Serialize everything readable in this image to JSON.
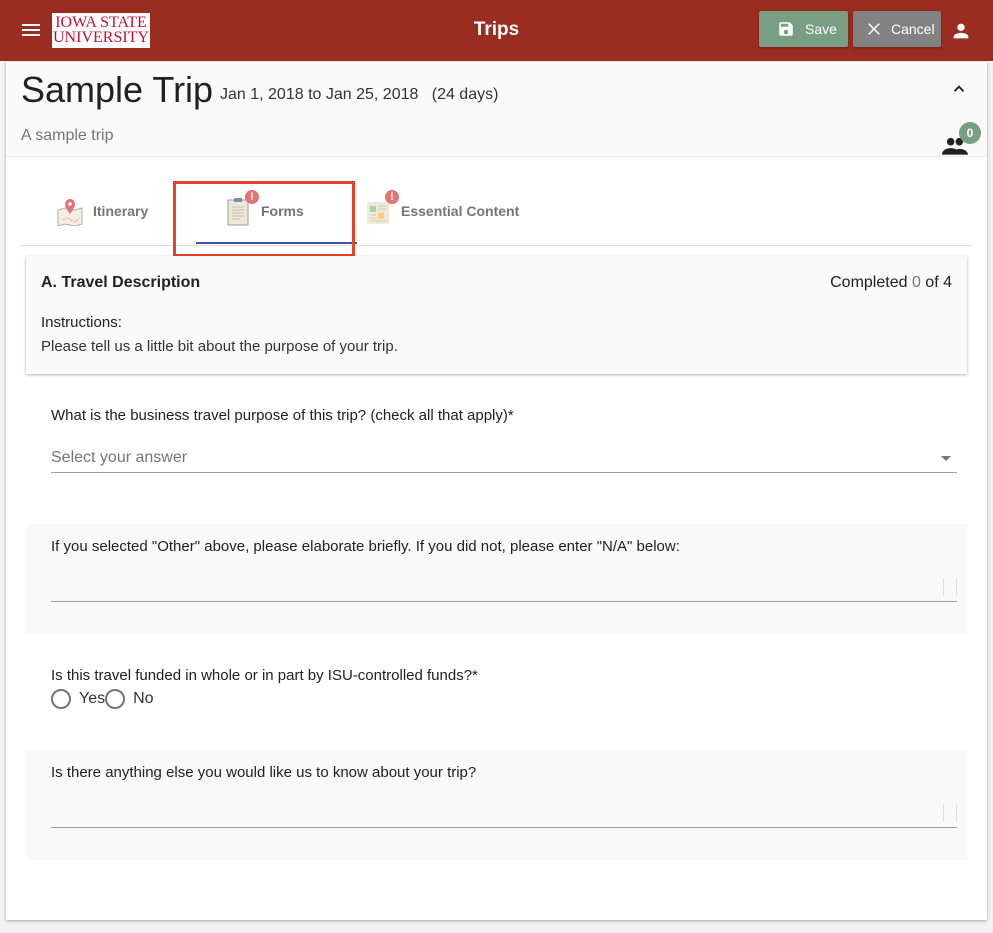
{
  "header": {
    "app_title": "Trips",
    "logo": {
      "line1": "IOWA STATE",
      "line2": "UNIVERSITY"
    },
    "save_label": "Save",
    "cancel_label": "Cancel",
    "colors": {
      "bar": "#9b2d20",
      "save": "#789e83",
      "cancel": "#828282"
    }
  },
  "trip": {
    "title": "Sample Trip",
    "dates": "Jan 1, 2018 to Jan 25, 2018",
    "duration": "(24 days)",
    "description": "A sample trip",
    "participants_count": "0"
  },
  "tabs": [
    {
      "label": "Itinerary",
      "icon": "map-pin-icon",
      "alert": false
    },
    {
      "label": "Forms",
      "icon": "clipboard-icon",
      "alert": true,
      "alert_glyph": "!",
      "active": true
    },
    {
      "label": "Essential Content",
      "icon": "newspaper-icon",
      "alert": true,
      "alert_glyph": "!"
    }
  ],
  "section": {
    "title": "A. Travel Description",
    "progress_prefix": "Completed",
    "completed": "0",
    "progress_mid": "of",
    "total": "4",
    "instructions_label": "Instructions:",
    "instructions_text": "Please tell us a little bit about the purpose of your trip."
  },
  "questions": [
    {
      "label": "What is the business travel purpose of this trip? (check all that apply)*",
      "type": "select",
      "placeholder": "Select your answer",
      "value": ""
    },
    {
      "label": "If you selected \"Other\" above, please elaborate briefly. If you did not, please enter \"N/A\" below:",
      "type": "textarea",
      "value": ""
    },
    {
      "label": "Is this travel funded in whole or in part by ISU-controlled funds?*",
      "type": "radio",
      "options": [
        "Yes",
        "No"
      ],
      "selected": null
    },
    {
      "label": "Is there anything else you would like us to know about your trip?",
      "type": "textarea",
      "value": ""
    }
  ]
}
